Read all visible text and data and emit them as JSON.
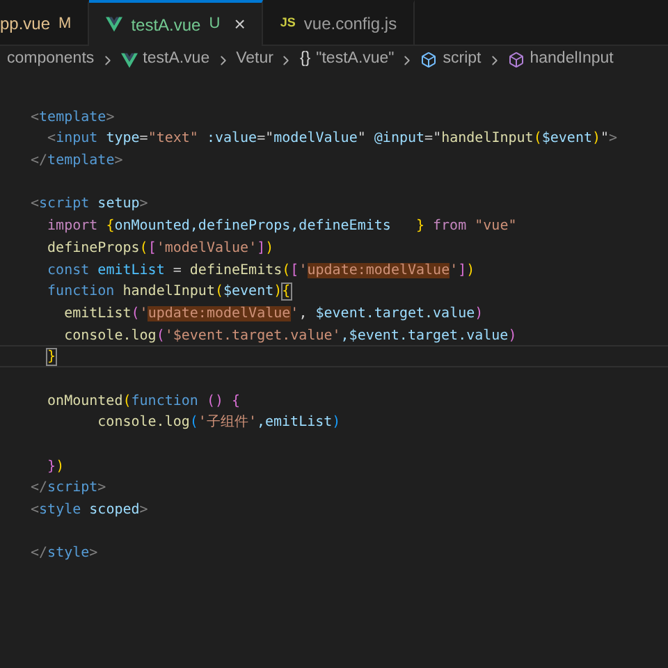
{
  "tabs": [
    {
      "label": "pp.vue",
      "kind": "plain",
      "status": "M",
      "color": "#e2c08d",
      "selected": false,
      "closable": false
    },
    {
      "label": "testA.vue",
      "kind": "vue",
      "status": "U",
      "color": "#73c991",
      "selected": true,
      "closable": true
    },
    {
      "label": "vue.config.js",
      "kind": "js",
      "icon_text": "JS",
      "selected": false,
      "closable": false
    }
  ],
  "close_glyph": "×",
  "breadcrumbs": [
    {
      "label": "components",
      "kind": "folder"
    },
    {
      "label": "testA.vue",
      "kind": "vue"
    },
    {
      "label": "Vetur",
      "kind": "plain"
    },
    {
      "label": "\"testA.vue\"",
      "kind": "braces",
      "icon_text": "{}"
    },
    {
      "label": "script",
      "kind": "module"
    },
    {
      "label": "handelInput",
      "kind": "method"
    }
  ],
  "code_lines": [
    {
      "kind": "blank"
    },
    {
      "kind": "code",
      "tokens": [
        {
          "text": "<",
          "kind": "punct"
        },
        {
          "text": "template",
          "kind": "tag"
        },
        {
          "text": ">",
          "kind": "punct"
        }
      ]
    },
    {
      "kind": "code",
      "tokens": [
        {
          "text": "  <",
          "kind": "punct"
        },
        {
          "text": "input",
          "kind": "tag"
        },
        {
          "text": " type",
          "kind": "attr"
        },
        {
          "text": "=",
          "kind": "plain"
        },
        {
          "text": "\"text\"",
          "kind": "str"
        },
        {
          "text": " :value",
          "kind": "attr"
        },
        {
          "text": "=\"",
          "kind": "plain"
        },
        {
          "text": "modelValue",
          "kind": "var"
        },
        {
          "text": "\"",
          "kind": "plain"
        },
        {
          "text": " @input",
          "kind": "attr"
        },
        {
          "text": "=\"",
          "kind": "plain"
        },
        {
          "text": "handelInput",
          "kind": "fn"
        },
        {
          "text": "(",
          "kind": "b1"
        },
        {
          "text": "$event",
          "kind": "var"
        },
        {
          "text": ")",
          "kind": "b1"
        },
        {
          "text": "\"",
          "kind": "plain"
        },
        {
          "text": ">",
          "kind": "punct"
        }
      ]
    },
    {
      "kind": "code",
      "tokens": [
        {
          "text": "</",
          "kind": "punct"
        },
        {
          "text": "template",
          "kind": "tag"
        },
        {
          "text": ">",
          "kind": "punct"
        }
      ]
    },
    {
      "kind": "blank"
    },
    {
      "kind": "code",
      "tokens": [
        {
          "text": "<",
          "kind": "punct"
        },
        {
          "text": "script",
          "kind": "tag"
        },
        {
          "text": " setup",
          "kind": "attr"
        },
        {
          "text": ">",
          "kind": "punct"
        }
      ]
    },
    {
      "kind": "code",
      "tokens": [
        {
          "text": "  import",
          "kind": "kw"
        },
        {
          "text": " {",
          "kind": "b1"
        },
        {
          "text": "onMounted,defineProps,defineEmits",
          "kind": "var"
        },
        {
          "text": "   }",
          "kind": "b1"
        },
        {
          "text": " from",
          "kind": "kw"
        },
        {
          "text": " \"vue\"",
          "kind": "str"
        }
      ]
    },
    {
      "kind": "code",
      "tokens": [
        {
          "text": "  defineProps",
          "kind": "fn"
        },
        {
          "text": "(",
          "kind": "b1"
        },
        {
          "text": "[",
          "kind": "b2"
        },
        {
          "text": "'modelValue'",
          "kind": "str"
        },
        {
          "text": "]",
          "kind": "b2"
        },
        {
          "text": ")",
          "kind": "b1"
        }
      ]
    },
    {
      "kind": "code",
      "tokens": [
        {
          "text": "  const",
          "kind": "storage"
        },
        {
          "text": " emitList",
          "kind": "const"
        },
        {
          "text": " = ",
          "kind": "plain"
        },
        {
          "text": "defineEmits",
          "kind": "fn"
        },
        {
          "text": "(",
          "kind": "b1"
        },
        {
          "text": "[",
          "kind": "b2"
        },
        {
          "text": "'",
          "kind": "str"
        },
        {
          "text": "update:modelValue",
          "kind": "str",
          "highlighted": true
        },
        {
          "text": "'",
          "kind": "str"
        },
        {
          "text": "]",
          "kind": "b2"
        },
        {
          "text": ")",
          "kind": "b1"
        }
      ]
    },
    {
      "kind": "code",
      "tokens": [
        {
          "text": "  function",
          "kind": "storage"
        },
        {
          "text": " handelInput",
          "kind": "fn"
        },
        {
          "text": "(",
          "kind": "b1"
        },
        {
          "text": "$event",
          "kind": "var"
        },
        {
          "text": ")",
          "kind": "b1"
        },
        {
          "text": "{",
          "kind": "b1",
          "matched": true
        }
      ]
    },
    {
      "kind": "code",
      "tokens": [
        {
          "text": "    emitList",
          "kind": "fn"
        },
        {
          "text": "(",
          "kind": "b2"
        },
        {
          "text": "'",
          "kind": "str"
        },
        {
          "text": "update:modelValue",
          "kind": "str",
          "highlighted": true
        },
        {
          "text": "'",
          "kind": "str"
        },
        {
          "text": ", ",
          "kind": "plain"
        },
        {
          "text": "$event.target.value",
          "kind": "var"
        },
        {
          "text": ")",
          "kind": "b2"
        }
      ]
    },
    {
      "kind": "code",
      "tokens": [
        {
          "text": "    console.log",
          "kind": "fn"
        },
        {
          "text": "(",
          "kind": "b2"
        },
        {
          "text": "'$event.target.value'",
          "kind": "str"
        },
        {
          "text": ",$event.target.value",
          "kind": "var"
        },
        {
          "text": ")",
          "kind": "b2"
        }
      ]
    },
    {
      "kind": "code",
      "current": true,
      "tokens": [
        {
          "text": "  }",
          "kind": "b1",
          "matched": true
        }
      ]
    },
    {
      "kind": "blank"
    },
    {
      "kind": "code",
      "tokens": [
        {
          "text": "  onMounted",
          "kind": "fn"
        },
        {
          "text": "(",
          "kind": "b1"
        },
        {
          "text": "function",
          "kind": "storage"
        },
        {
          "text": " ()",
          "kind": "b2"
        },
        {
          "text": " {",
          "kind": "b2"
        }
      ]
    },
    {
      "kind": "code",
      "tokens": [
        {
          "text": "        console.log",
          "kind": "fn"
        },
        {
          "text": "(",
          "kind": "b3"
        },
        {
          "text": "'子组件'",
          "kind": "str"
        },
        {
          "text": ",emitList",
          "kind": "var"
        },
        {
          "text": ")",
          "kind": "b3"
        }
      ]
    },
    {
      "kind": "blank"
    },
    {
      "kind": "code",
      "tokens": [
        {
          "text": "  }",
          "kind": "b2"
        },
        {
          "text": ")",
          "kind": "b1"
        }
      ]
    },
    {
      "kind": "code",
      "tokens": [
        {
          "text": "</",
          "kind": "punct"
        },
        {
          "text": "script",
          "kind": "tag"
        },
        {
          "text": ">",
          "kind": "punct"
        }
      ]
    },
    {
      "kind": "code",
      "tokens": [
        {
          "text": "<",
          "kind": "punct"
        },
        {
          "text": "style",
          "kind": "tag"
        },
        {
          "text": " scoped",
          "kind": "attr"
        },
        {
          "text": ">",
          "kind": "punct"
        }
      ]
    },
    {
      "kind": "blank"
    },
    {
      "kind": "code",
      "tokens": [
        {
          "text": "</",
          "kind": "punct"
        },
        {
          "text": "style",
          "kind": "tag"
        },
        {
          "text": ">",
          "kind": "punct"
        }
      ]
    }
  ]
}
